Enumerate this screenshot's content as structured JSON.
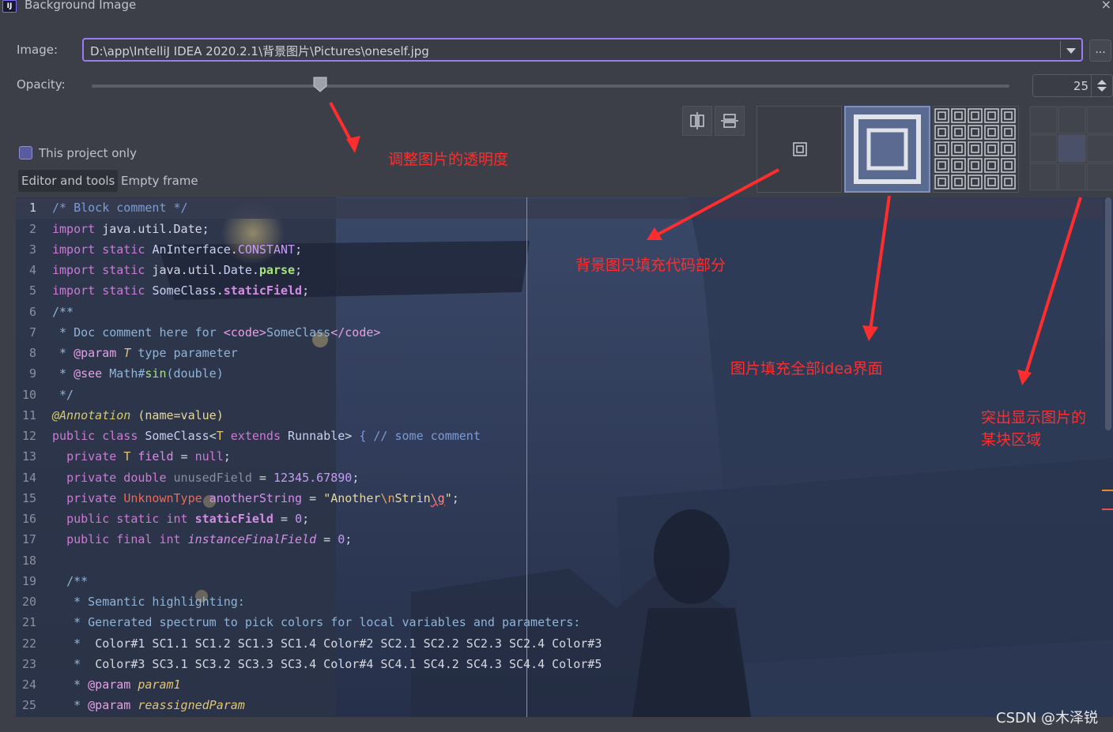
{
  "window": {
    "title": "Background Image",
    "app_icon": "IJ"
  },
  "image_field": {
    "label": "Image:",
    "value": "D:\\app\\IntelliJ IDEA 2020.2.1\\背景图片\\Pictures\\oneself.jpg",
    "browse_label": "..."
  },
  "opacity": {
    "label": "Opacity:",
    "value": "25",
    "level_percent": 25
  },
  "checkbox": {
    "label": "This project only"
  },
  "tabs": [
    {
      "label": "Editor and tools",
      "active": true
    },
    {
      "label": "Empty frame",
      "active": false
    }
  ],
  "code_lines": [
    "1",
    "2",
    "3",
    "4",
    "5",
    "6",
    "7",
    "8",
    "9",
    "10",
    "11",
    "12",
    "13",
    "14",
    "15",
    "16",
    "17",
    "18",
    "19",
    "20",
    "21",
    "22",
    "23",
    "24",
    "25"
  ],
  "annotations": {
    "opacity_note": "调整图片的透明度",
    "editor_only_note": "背景图只填充代码部分",
    "fill_all_note": "图片填充全部idea界面",
    "highlight_note_line1": "突出显示图片的",
    "highlight_note_line2": "某块区域"
  },
  "watermark": "CSDN @木泽锐",
  "colors": {
    "accent": "#9b7cf2",
    "annotation_red": "#ff2d2d",
    "panel_bg": "#3c3f47"
  },
  "icons": [
    "window-close-icon",
    "combo-dropdown-icon",
    "slider-thumb-icon",
    "align-horizontal-center-icon",
    "align-vertical-center-icon"
  ]
}
